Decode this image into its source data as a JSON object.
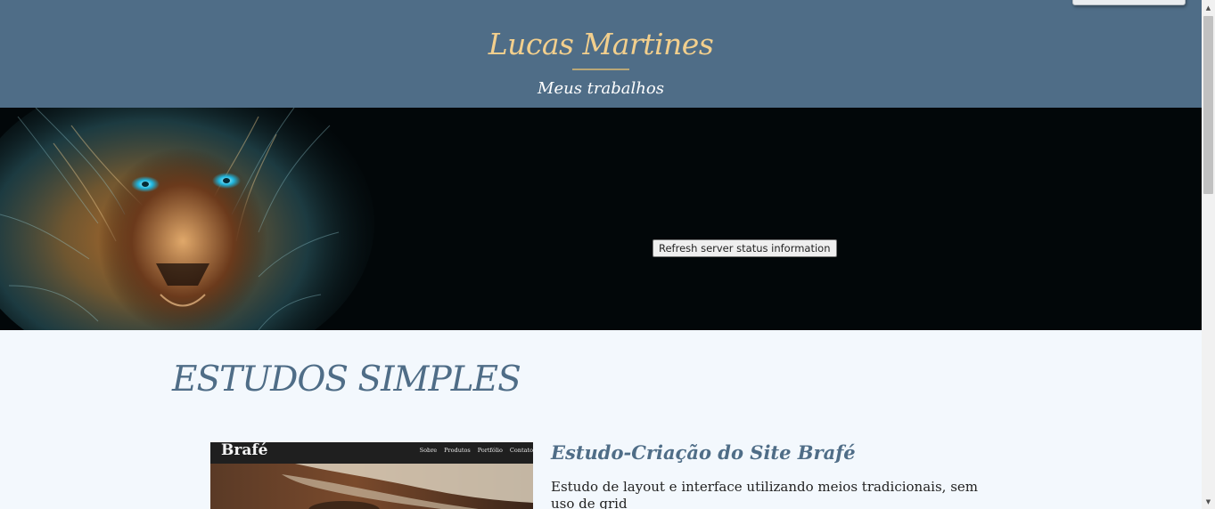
{
  "header": {
    "title": "Lucas Martines",
    "subtitle": "Meus trabalhos"
  },
  "hero": {
    "image_icon": "lion-artwork",
    "refresh_button_label": "Refresh server status information"
  },
  "section": {
    "title": "ESTUDOS SIMPLES"
  },
  "project": {
    "thumbnail": {
      "logo": "Brafé",
      "nav": [
        "Sobre",
        "Produtos",
        "Portfólio",
        "Contato"
      ]
    },
    "title": "Estudo-Criação do Site Brafé",
    "description": "Estudo de layout e interface utilizando meios tradicionais, sem uso de grid"
  },
  "colors": {
    "header_bg": "#4f6d87",
    "title_gold": "#f2cf8d",
    "page_bg": "#f3f8fd",
    "hero_bg": "#020709"
  }
}
